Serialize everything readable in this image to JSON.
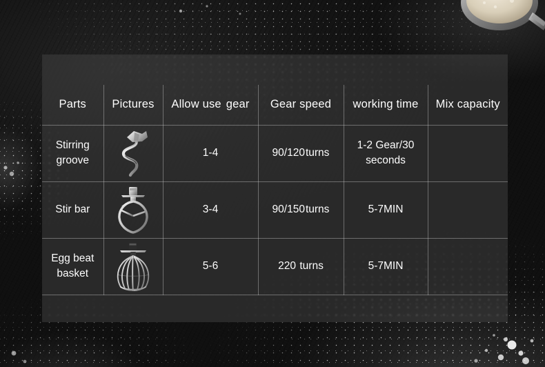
{
  "scene": {
    "background_description": "dark stone countertop with scattered flour",
    "bowl_icon": "mixing-bowl-with-batter"
  },
  "table": {
    "headers": [
      {
        "label": "Parts",
        "name": "parts"
      },
      {
        "label": "Pictures",
        "name": "pictures"
      },
      {
        "label": "Allow use  gear",
        "label_a": "Allow use",
        "label_b": "gear",
        "name": "allow-use-gear"
      },
      {
        "label": "Gear speed",
        "name": "gear-speed"
      },
      {
        "label": "working time",
        "name": "working-time"
      },
      {
        "label": "Mix capacity",
        "name": "mix-capacity"
      }
    ],
    "rows": [
      {
        "part_line1": "Stirring",
        "part_line2": "groove",
        "picture": "dough-hook-icon",
        "allow_use_gear": "1-4",
        "gear_speed_value": "90/120",
        "gear_speed_unit": "turns",
        "working_time_line1": "1-2 Gear/30",
        "working_time_line2": "seconds",
        "working_time_centered": true,
        "mix_capacity": ""
      },
      {
        "part_line1": "Stir bar",
        "part_line2": "",
        "picture": "flat-beater-icon",
        "allow_use_gear": "3-4",
        "gear_speed_value": "90/150",
        "gear_speed_unit": "turns",
        "working_time_line1": "5-7MIN",
        "working_time_line2": "",
        "working_time_centered": false,
        "mix_capacity": ""
      },
      {
        "part_line1": "Egg beat",
        "part_line2": "basket",
        "picture": "wire-whisk-icon",
        "allow_use_gear": "5-6",
        "gear_speed_value": "220",
        "gear_speed_unit": "turns",
        "working_time_line1": "5-7MIN",
        "working_time_line2": "",
        "working_time_centered": false,
        "mix_capacity": ""
      }
    ]
  },
  "colors": {
    "panel_fill": "#484848",
    "grid_line": "#cdcdcd",
    "text": "#fdfdfd",
    "background_dark": "#161616",
    "flour_white": "#ffffff",
    "metal_light": "#d8d8d8",
    "metal_dark": "#6a6a6a"
  }
}
